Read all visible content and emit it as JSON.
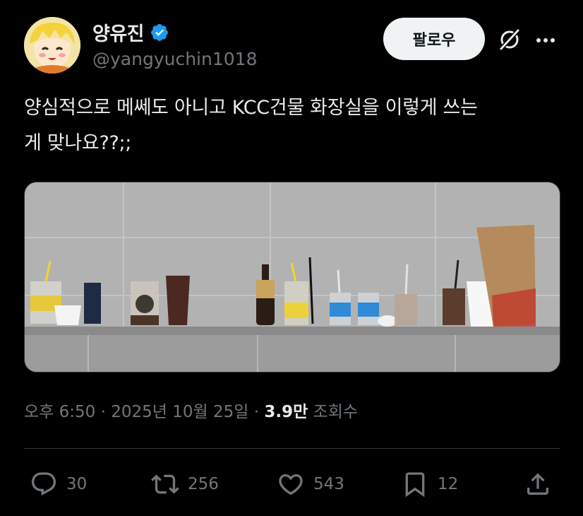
{
  "user": {
    "display_name": "양유진",
    "handle": "@yangyuchin1018",
    "verified": true,
    "avatar_icon": "anime-avatar"
  },
  "follow_button_label": "팔로우",
  "tweet": {
    "line1": "양심적으로 메쎄도 아니고 KCC건물 화장실을 이렇게 쓰는",
    "line2": "게 맞나요??;;"
  },
  "meta": {
    "time": "오후 6:50",
    "separator1": " · ",
    "date": "2025년 10월 25일",
    "separator2": " · ",
    "views_count": "3.9만",
    "views_label": " 조회수"
  },
  "actions": {
    "reply_count": "30",
    "retweet_count": "256",
    "like_count": "543",
    "bookmark_count": "12"
  },
  "colors": {
    "background": "#000000",
    "text": "#e7e9ea",
    "muted": "#71767b",
    "verified": "#1d9bf0",
    "follow_bg": "#eff3f4"
  }
}
